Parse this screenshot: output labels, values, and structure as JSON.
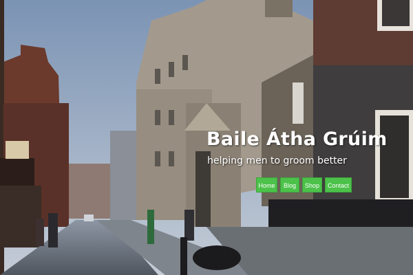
{
  "hero": {
    "title": "Baile Átha Grúim",
    "tagline": "helping men to groom better"
  },
  "nav": {
    "items": [
      "Home",
      "Blog",
      "Shop",
      "Contact"
    ]
  },
  "colors": {
    "nav_button": "#4cc24a",
    "text": "#ffffff",
    "sky": "#7f97b3"
  }
}
